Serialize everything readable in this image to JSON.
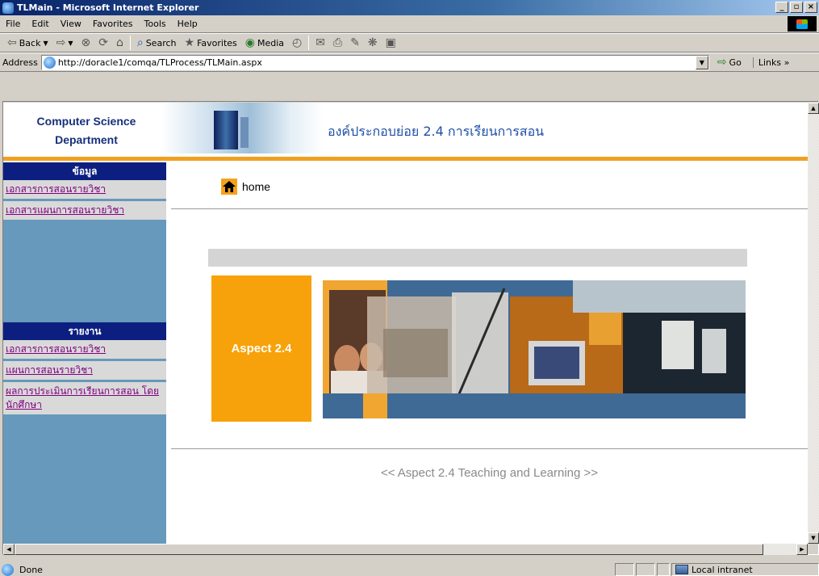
{
  "window": {
    "title": "TLMain - Microsoft Internet Explorer",
    "minimize": "_",
    "maximize": "▫",
    "close": "×"
  },
  "menu": [
    "File",
    "Edit",
    "View",
    "Favorites",
    "Tools",
    "Help"
  ],
  "toolbar": {
    "back": "Back",
    "search": "Search",
    "favorites": "Favorites",
    "media": "Media"
  },
  "address": {
    "label": "Address",
    "url": "http://doracle1/comqa/TLProcess/TLMain.aspx",
    "go": "Go",
    "links": "Links"
  },
  "header": {
    "dept_line1": "Computer Science",
    "dept_line2": "Department",
    "title": "องค์ประกอบย่อย 2.4 การเรียนการสอน"
  },
  "sidebar": {
    "section1_title": "ข้อมูล",
    "section1_links": [
      "เอกสารการสอนรายวิชา",
      "เอกสารแผนการสอนรายวิชา"
    ],
    "section2_title": "รายงาน",
    "section2_links": [
      "เอกสารการสอนรายวิชา",
      "แผนการสอนรายวิชา",
      "ผลการประเมินการเรียนการสอน โดยนักศึกษา"
    ]
  },
  "main": {
    "home_label": "home",
    "aspect_label": "Aspect 2.4",
    "footer": "<< Aspect 2.4 Teaching and Learning >>"
  },
  "status": {
    "text": "Done",
    "zone": "Local intranet"
  },
  "colors": {
    "sidebar_bg": "#6699bb",
    "sidebar_head": "#0c1f80",
    "accent_orange": "#f7a20a",
    "link_color": "#800080"
  }
}
